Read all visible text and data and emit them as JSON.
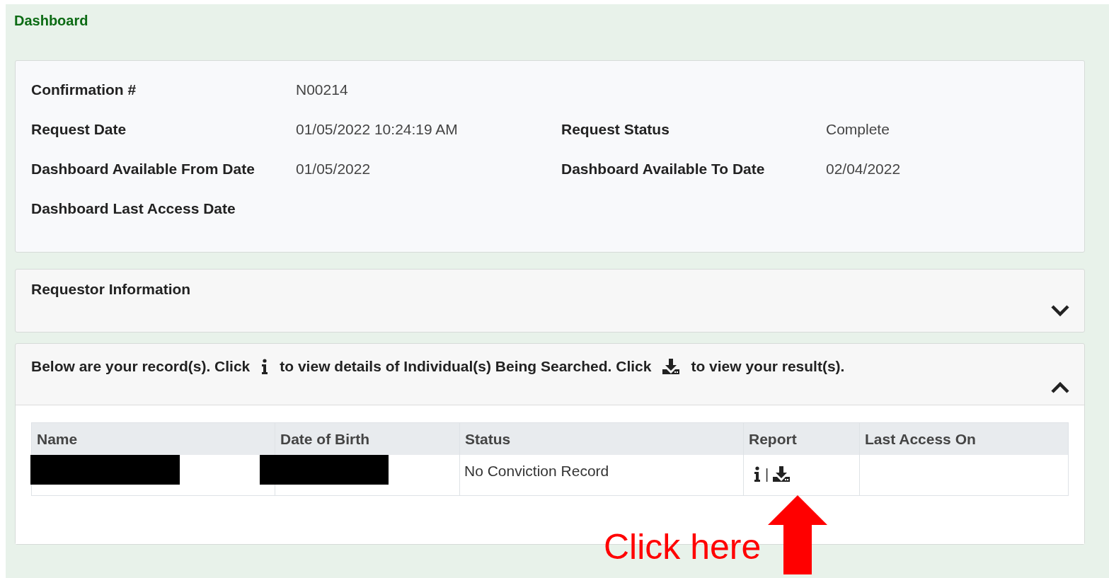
{
  "page_title": "Dashboard",
  "summary": {
    "rows": [
      [
        {
          "label": "Confirmation #",
          "value": "N00214"
        }
      ],
      [
        {
          "label": "Request Date",
          "value": "01/05/2022 10:24:19 AM"
        },
        {
          "label": "Request Status",
          "value": "Complete"
        }
      ],
      [
        {
          "label": "Dashboard Available From Date",
          "value": "01/05/2022"
        },
        {
          "label": "Dashboard Available To Date",
          "value": "02/04/2022"
        }
      ],
      [
        {
          "label": "Dashboard Last Access Date"
        }
      ]
    ]
  },
  "requestor_panel": {
    "title": "Requestor Information",
    "expanded": false
  },
  "records_panel": {
    "expanded": true,
    "intro": [
      {
        "kind": "text",
        "text": "Below are your record(s). Click"
      },
      {
        "kind": "info_icon"
      },
      {
        "kind": "text",
        "text": "to view details of Individual(s) Being Searched. Click"
      },
      {
        "kind": "download_icon"
      },
      {
        "kind": "text",
        "text": "to view your result(s)."
      }
    ],
    "table": {
      "columns": [
        "Name",
        "Date of Birth",
        "Status",
        "Report",
        "Last Access On"
      ],
      "rows": [
        {
          "name_redacted": true,
          "dob_redacted": true,
          "status": "No Conviction Record",
          "report": {
            "actions": [
              {
                "kind": "info"
              },
              {
                "kind": "download"
              }
            ],
            "separator": "|"
          }
        }
      ]
    }
  },
  "annotation": {
    "text": "Click here"
  }
}
